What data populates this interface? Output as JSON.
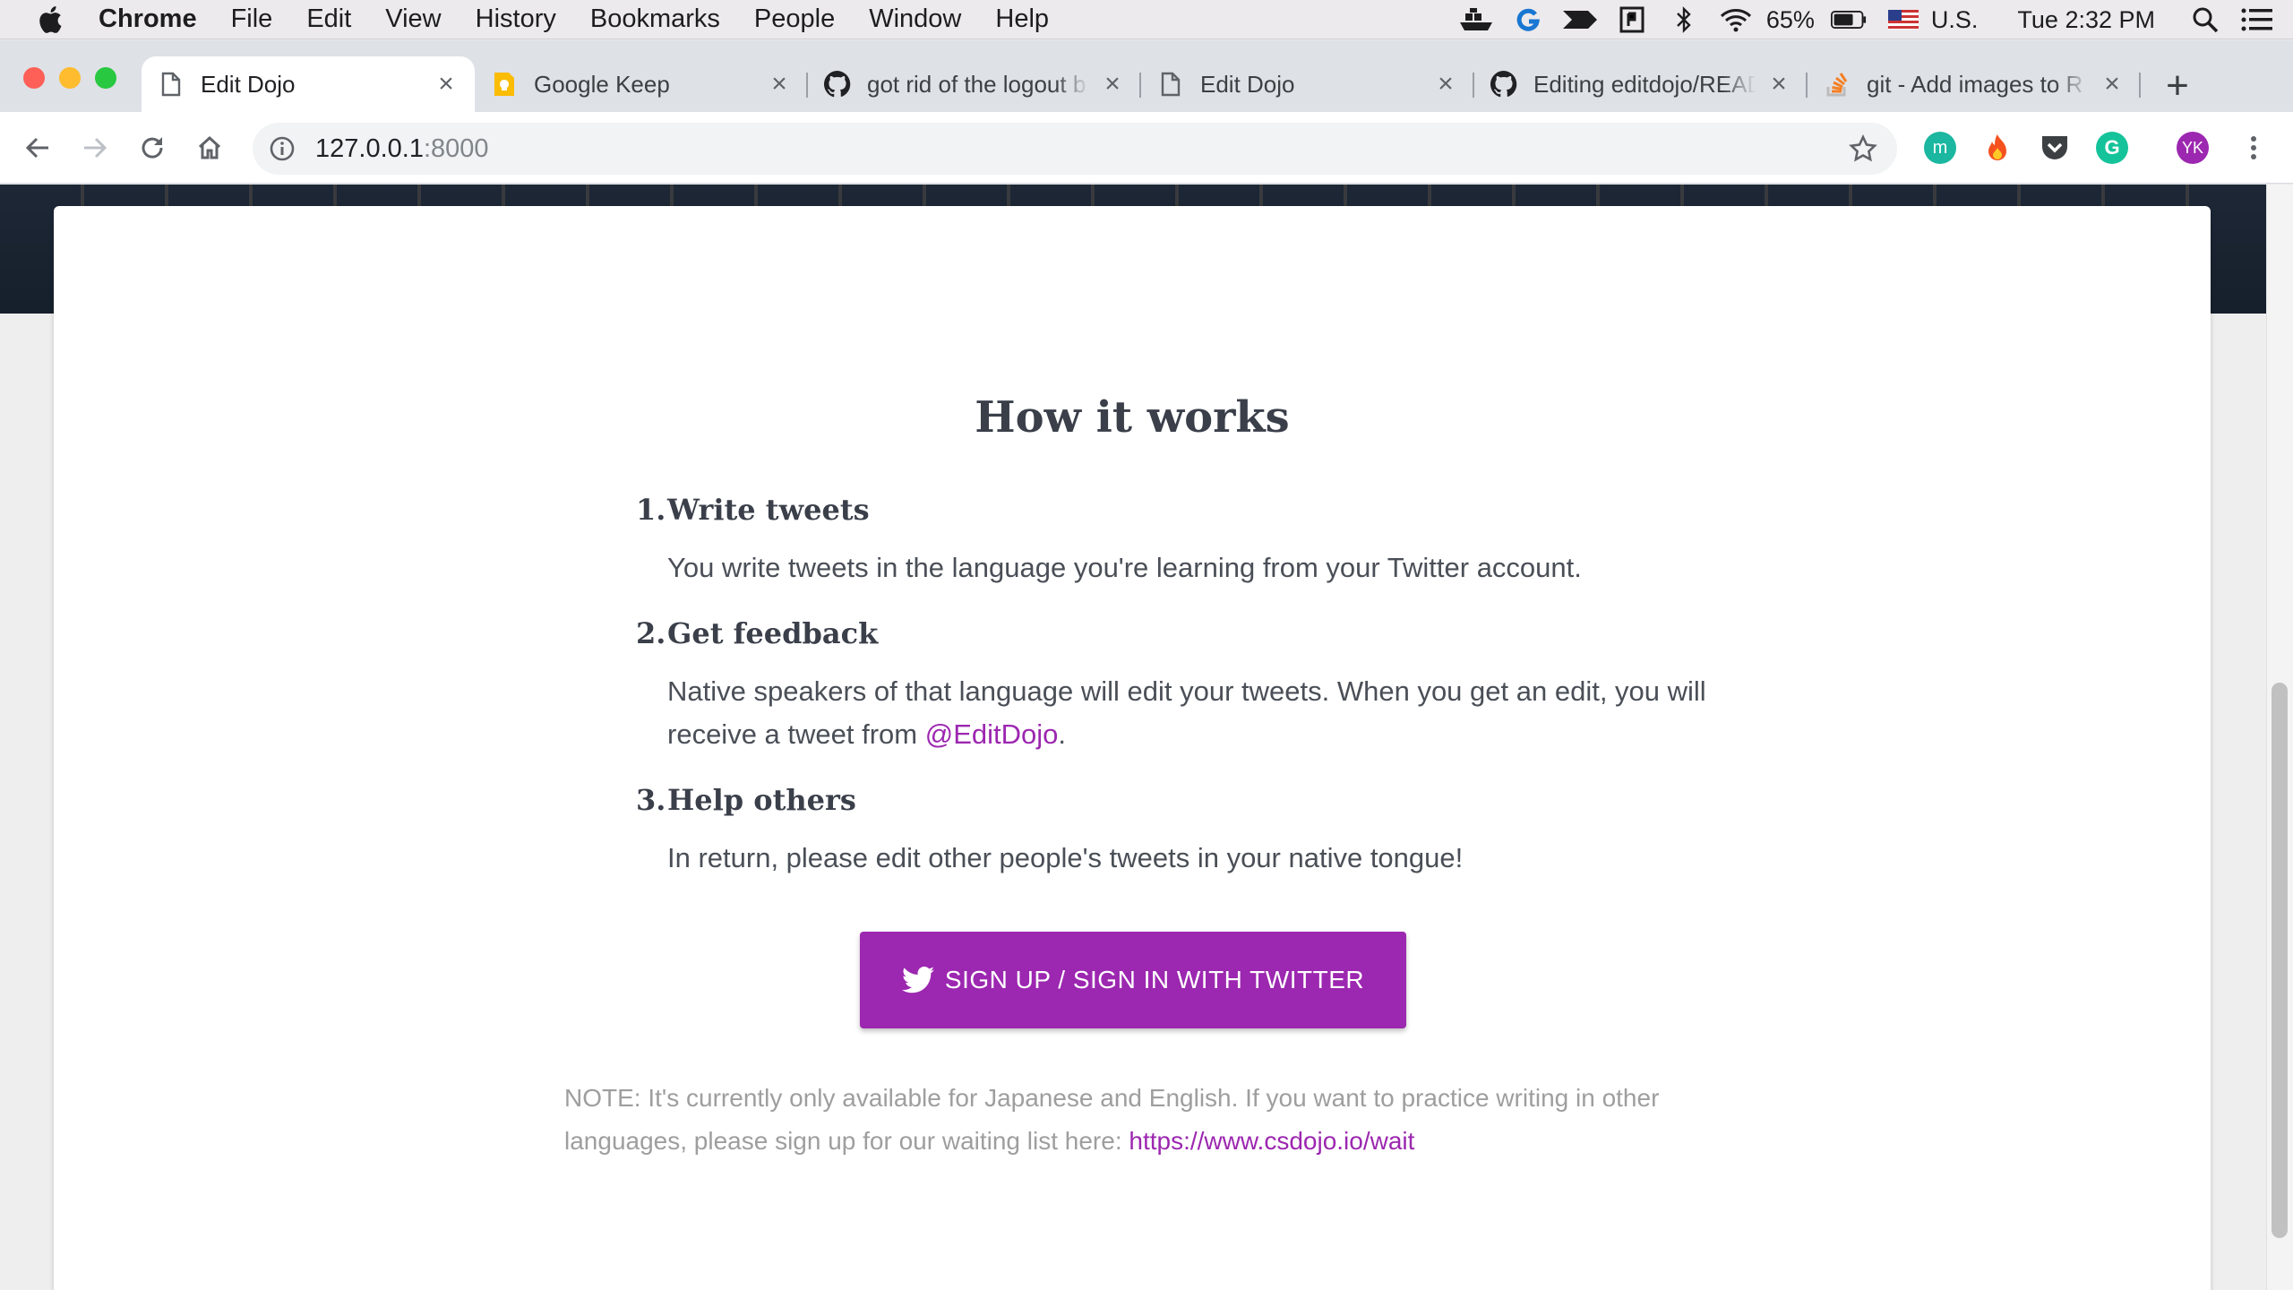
{
  "menubar": {
    "app": "Chrome",
    "items": [
      "File",
      "Edit",
      "View",
      "History",
      "Bookmarks",
      "People",
      "Window",
      "Help"
    ],
    "battery": "65%",
    "input_source": "U.S.",
    "clock": "Tue 2:32 PM"
  },
  "tabs": [
    {
      "title": "Edit Dojo",
      "icon": "page-icon",
      "active": true
    },
    {
      "title": "Google Keep",
      "icon": "keep-icon",
      "active": false
    },
    {
      "title": "got rid of the logout b",
      "icon": "github-icon",
      "active": false
    },
    {
      "title": "Edit Dojo",
      "icon": "page-icon",
      "active": false
    },
    {
      "title": "Editing editdojo/READ",
      "icon": "github-icon",
      "active": false
    },
    {
      "title": "git - Add images to R",
      "icon": "stackoverflow-icon",
      "active": false
    }
  ],
  "address": {
    "host": "127.0.0.1",
    "port": ":8000"
  },
  "profile": {
    "initials": "YK",
    "color": "#9c27b0"
  },
  "page": {
    "section_title": "How it works",
    "steps": [
      {
        "num": "1.",
        "title": "Write tweets",
        "body": "You write tweets in the language you're learning from your Twitter account."
      },
      {
        "num": "2.",
        "title": "Get feedback",
        "body_before": "Native speakers of that language will edit your tweets. When you get an edit, you will receive a tweet from ",
        "link": "@EditDojo",
        "body_after": "."
      },
      {
        "num": "3.",
        "title": "Help others",
        "body": "In return, please edit other people's tweets in your native tongue!"
      }
    ],
    "cta_label": "SIGN UP / SIGN IN WITH TWITTER",
    "note_text": "NOTE: It's currently only available for Japanese and English. If you want to practice writing in other languages, please sign up for our waiting list here: ",
    "note_link": "https://www.csdojo.io/wait"
  },
  "colors": {
    "accent": "#9c27b0",
    "heading": "#3a3f4a",
    "body_text": "#4a4f57",
    "note_text": "#9e9e9e"
  }
}
